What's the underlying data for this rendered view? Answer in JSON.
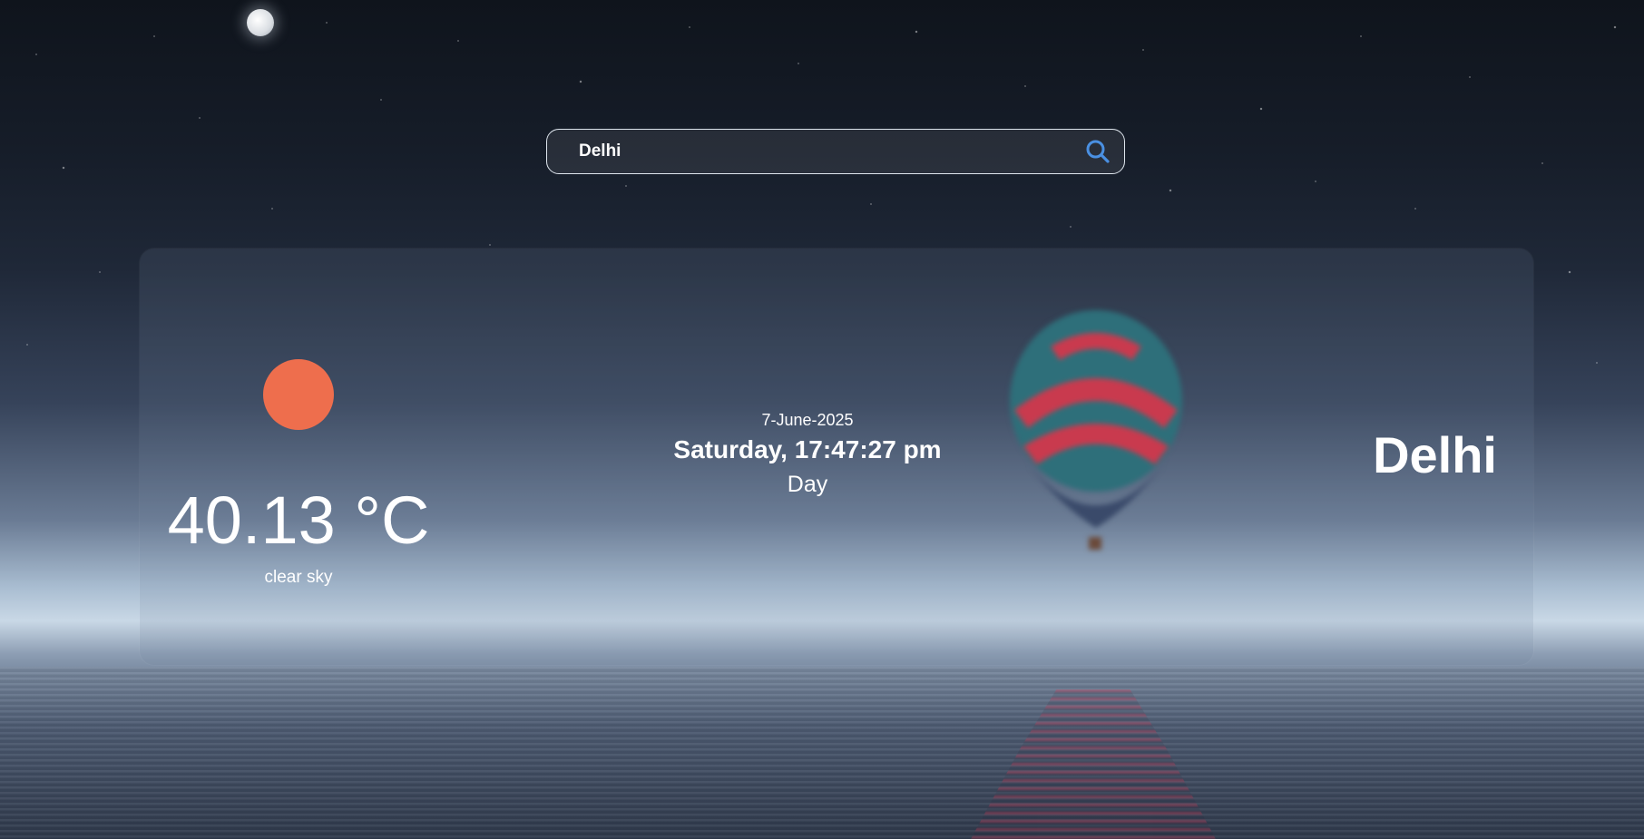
{
  "search": {
    "value": "Delhi",
    "icon": "search-icon",
    "accent_color": "#4a90e2"
  },
  "weather": {
    "temperature": "40.13 °C",
    "description": "clear sky",
    "icon": "sun-icon",
    "icon_color": "#ee6e4d"
  },
  "datetime": {
    "date": "7-June-2025",
    "day_time": "Saturday, 17:47:27 pm",
    "period": "Day"
  },
  "location": {
    "city": "Delhi"
  }
}
